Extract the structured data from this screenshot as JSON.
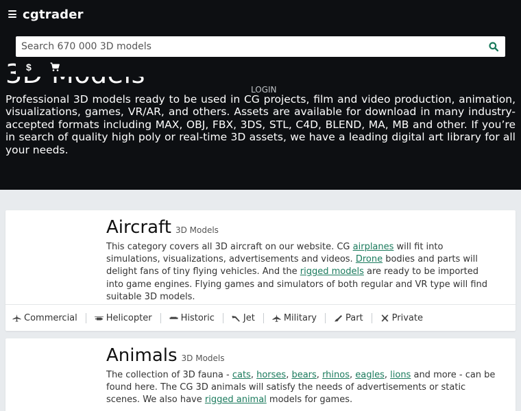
{
  "header": {
    "logo": "cgtrader",
    "search_placeholder": "Search 670 000 3D models",
    "currency": "$",
    "login": "LOGIN"
  },
  "hero": {
    "title": "3D Models",
    "text": "Professional 3D models ready to be used in CG projects, film and video production, animation, visualizations, games, VR/AR, and others. Assets are available for download in many industry-accepted formats including MAX, OBJ, FBX, 3DS, STL, C4D, BLEND, MA, MB and other. If you’re in search of quality high poly or real-time 3D assets, we have a leading digital art library for all your needs."
  },
  "categories": {
    "aircraft": {
      "title": "Aircraft",
      "subtitle": "3D Models",
      "desc": {
        "t1": "This category covers all 3D aircraft on our website. CG ",
        "l1": "airplanes",
        "t2": " will fit into simulations, visualizations, advertisements and videos. ",
        "l2": "Drone",
        "t3": " bodies and parts will delight fans of tiny flying vehicles. And the ",
        "l3": "rigged models",
        "t4": " are ready to be imported into game engines. Flying games and simulators of both regular and VR type will find suitable 3D models."
      },
      "tags": [
        "Commercial",
        "Helicopter",
        "Historic",
        "Jet",
        "Military",
        "Part",
        "Private"
      ]
    },
    "animals": {
      "title": "Animals",
      "subtitle": "3D Models",
      "desc": {
        "t1": "The collection of 3D fauna - ",
        "l1": "cats",
        "s1": ", ",
        "l2": "horses",
        "s2": ", ",
        "l3": "bears",
        "s3": ", ",
        "l4": "rhinos",
        "s4": ", ",
        "l5": "eagles",
        "s5": ", ",
        "l6": "lions",
        "t2": " and more - can be found here. The CG 3D animals will satisfy the needs of advertisements or static scenes. We also have ",
        "l7": "rigged animal",
        "t3": " models for games."
      }
    }
  }
}
